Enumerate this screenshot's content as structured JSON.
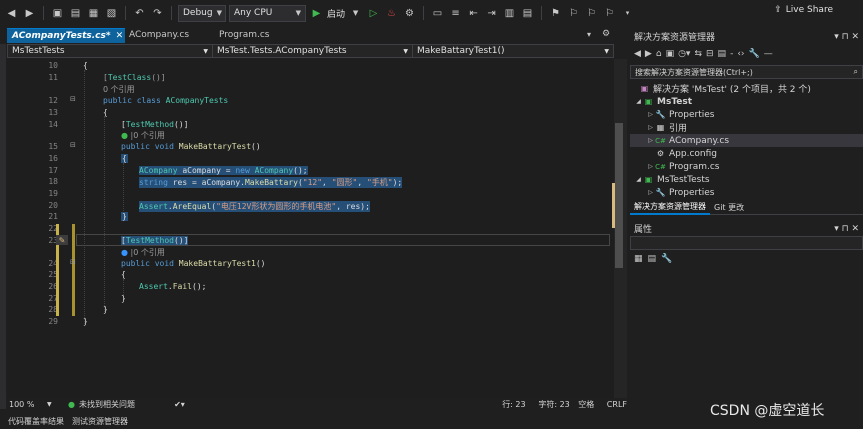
{
  "toolbar": {
    "config": "Debug",
    "platform": "Any CPU",
    "start_label": "启动",
    "live_share": "Live Share"
  },
  "tabs": [
    {
      "label": "ACompanyTests.cs*",
      "close": "✕"
    },
    {
      "label": "ACompany.cs"
    },
    {
      "label": "Program.cs"
    }
  ],
  "navbar": {
    "project": "MsTestTests",
    "class": "MsTest.Tests.ACompanyTests",
    "member": "MakeBattaryTest1()"
  },
  "editor": {
    "line_numbers": [
      "10",
      "11",
      "12",
      "13",
      "14",
      "15",
      "16",
      "17",
      "18",
      "19",
      "20",
      "21",
      "22",
      "23",
      "24",
      "25",
      "26",
      "27",
      "28",
      "29"
    ],
    "lines": [
      "{",
      "[TestClass()]",
      "public class ACompanyTests",
      "{",
      "[TestMethod()]",
      "public void MakeBattaryTest()",
      "{",
      "ACompany aCompany = new ACompany();",
      "string res = aCompany.MakeBattary(\"12\", \"圆形\", \"手机\");",
      "Assert.AreEqual(\"电压12V形状为圆形的手机电池\", res);",
      "}",
      "[TestMethod()]",
      "public void MakeBattaryTest1()",
      "{",
      "Assert.Fail();",
      "}",
      "}",
      "}"
    ],
    "lens_refs_0": "0 个引用",
    "lens_refs_1": "0 个引用",
    "lens_refs_2": "0 个引用"
  },
  "editor_status": {
    "zoom": "100 %",
    "issues": "未找到相关问题",
    "line": "行: 23",
    "col": "字符: 23",
    "ws": "空格",
    "eol": "CRLF"
  },
  "bottom_tabs": [
    "代码覆盖率结果",
    "测试资源管理器"
  ],
  "solution_explorer": {
    "title": "解决方案资源管理器",
    "search_placeholder": "搜索解决方案资源管理器(Ctrl+;)",
    "items": [
      {
        "label": "解决方案 'MsTest' (2 个项目，共 2 个)"
      },
      {
        "label": "MsTest"
      },
      {
        "label": "Properties"
      },
      {
        "label": "引用"
      },
      {
        "label": "ACompany.cs"
      },
      {
        "label": "App.config"
      },
      {
        "label": "Program.cs"
      },
      {
        "label": "MsTestTests"
      },
      {
        "label": "Properties"
      }
    ],
    "tab_se": "解决方案资源管理器",
    "tab_git": "Git 更改"
  },
  "properties": {
    "title": "属性"
  },
  "watermark": "CSDN @虚空道长",
  "colors": {
    "accent": "#007acc",
    "selection": "#264f78",
    "change_marker": "#c8b34b"
  }
}
